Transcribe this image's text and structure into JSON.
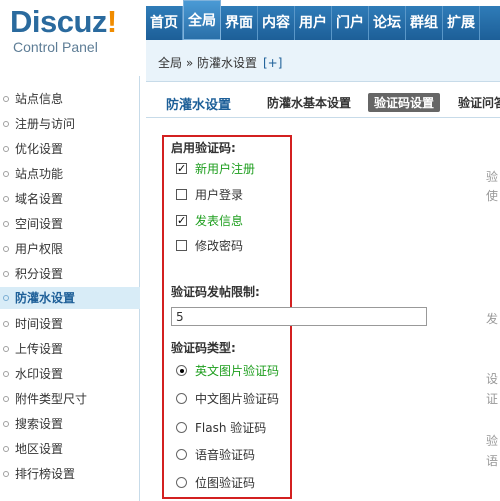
{
  "logo": {
    "brand": "Discuz",
    "bang": "!",
    "subtitle": "Control Panel"
  },
  "topnav": {
    "items": [
      "首页",
      "全局",
      "界面",
      "内容",
      "用户",
      "门户",
      "论坛",
      "群组",
      "扩展"
    ],
    "active": "全局"
  },
  "breadcrumb": {
    "path": "全局 » 防灌水设置",
    "add": "[+]"
  },
  "sidebar": {
    "items": [
      "站点信息",
      "注册与访问",
      "优化设置",
      "站点功能",
      "域名设置",
      "空间设置",
      "用户权限",
      "积分设置",
      "防灌水设置",
      "时间设置",
      "上传设置",
      "水印设置",
      "附件类型尺寸",
      "搜索设置",
      "地区设置",
      "排行榜设置"
    ],
    "active": "防灌水设置"
  },
  "page": {
    "title": "防灌水设置",
    "tabs": [
      "防灌水基本设置",
      "验证码设置",
      "验证问答"
    ],
    "active_tab": "验证码设置"
  },
  "form": {
    "enable_title": "启用验证码:",
    "enable_options": [
      {
        "label": "新用户注册",
        "checked": true
      },
      {
        "label": "用户登录",
        "checked": false
      },
      {
        "label": "发表信息",
        "checked": true
      },
      {
        "label": "修改密码",
        "checked": false
      }
    ],
    "limit_title": "验证码发帖限制:",
    "limit_value": "5",
    "type_title": "验证码类型:",
    "type_options": [
      {
        "label": "英文图片验证码",
        "selected": true
      },
      {
        "label": "中文图片验证码",
        "selected": false
      },
      {
        "label": "Flash 验证码",
        "selected": false
      },
      {
        "label": "语音验证码",
        "selected": false
      },
      {
        "label": "位图验证码",
        "selected": false
      }
    ]
  },
  "tips": [
    "验",
    "使",
    "发",
    "设",
    "证",
    "验",
    "语"
  ],
  "colors": {
    "nav_blue": "#1d5f98",
    "highlight_red": "#d32020",
    "checked_green": "#1e9e1e",
    "brand_orange": "#f08c00"
  }
}
